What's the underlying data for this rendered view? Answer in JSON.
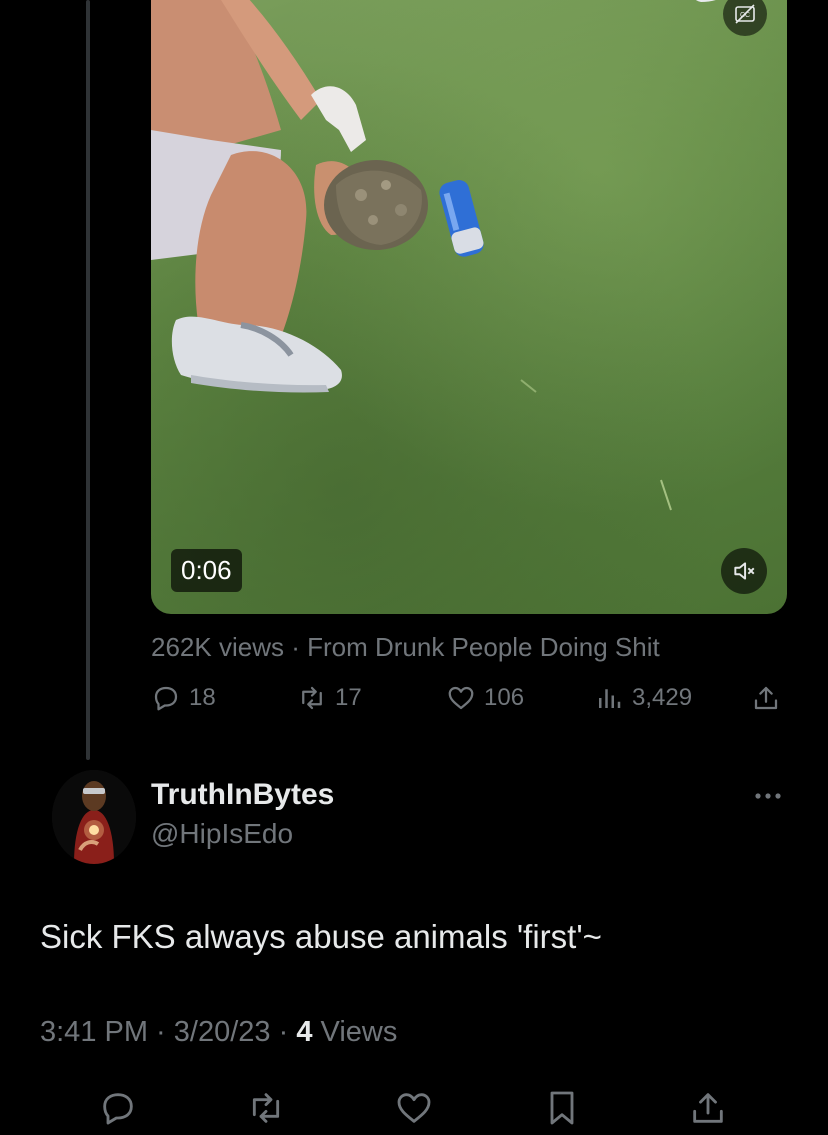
{
  "video": {
    "duration": "0:06",
    "icons": {
      "captions": "captions-off-icon",
      "mute": "muted-speaker-icon"
    }
  },
  "quoted": {
    "views": "262K",
    "views_suffix": " views",
    "separator": " · ",
    "source": "From Drunk People Doing Shit",
    "stats": {
      "replies": "18",
      "retweets": "17",
      "likes": "106",
      "analytics": "3,429"
    }
  },
  "reply": {
    "author_name": "TruthInBytes",
    "author_handle": "@HipIsEdo",
    "text": "Sick FKS always abuse animals 'first'~",
    "time": "3:41 PM",
    "sep1": " · ",
    "date": "3/20/23",
    "sep2": " · ",
    "views_count": "4",
    "views_label": " Views"
  },
  "icons": {
    "reply": "reply-icon",
    "retweet": "retweet-icon",
    "like": "heart-icon",
    "analytics": "analytics-icon",
    "share": "share-icon",
    "bookmark": "bookmark-icon",
    "more": "more-icon"
  },
  "colors": {
    "background": "#000000",
    "text_primary": "#e7e9ea",
    "text_secondary": "#71767b",
    "thread_line": "#2f3336"
  }
}
